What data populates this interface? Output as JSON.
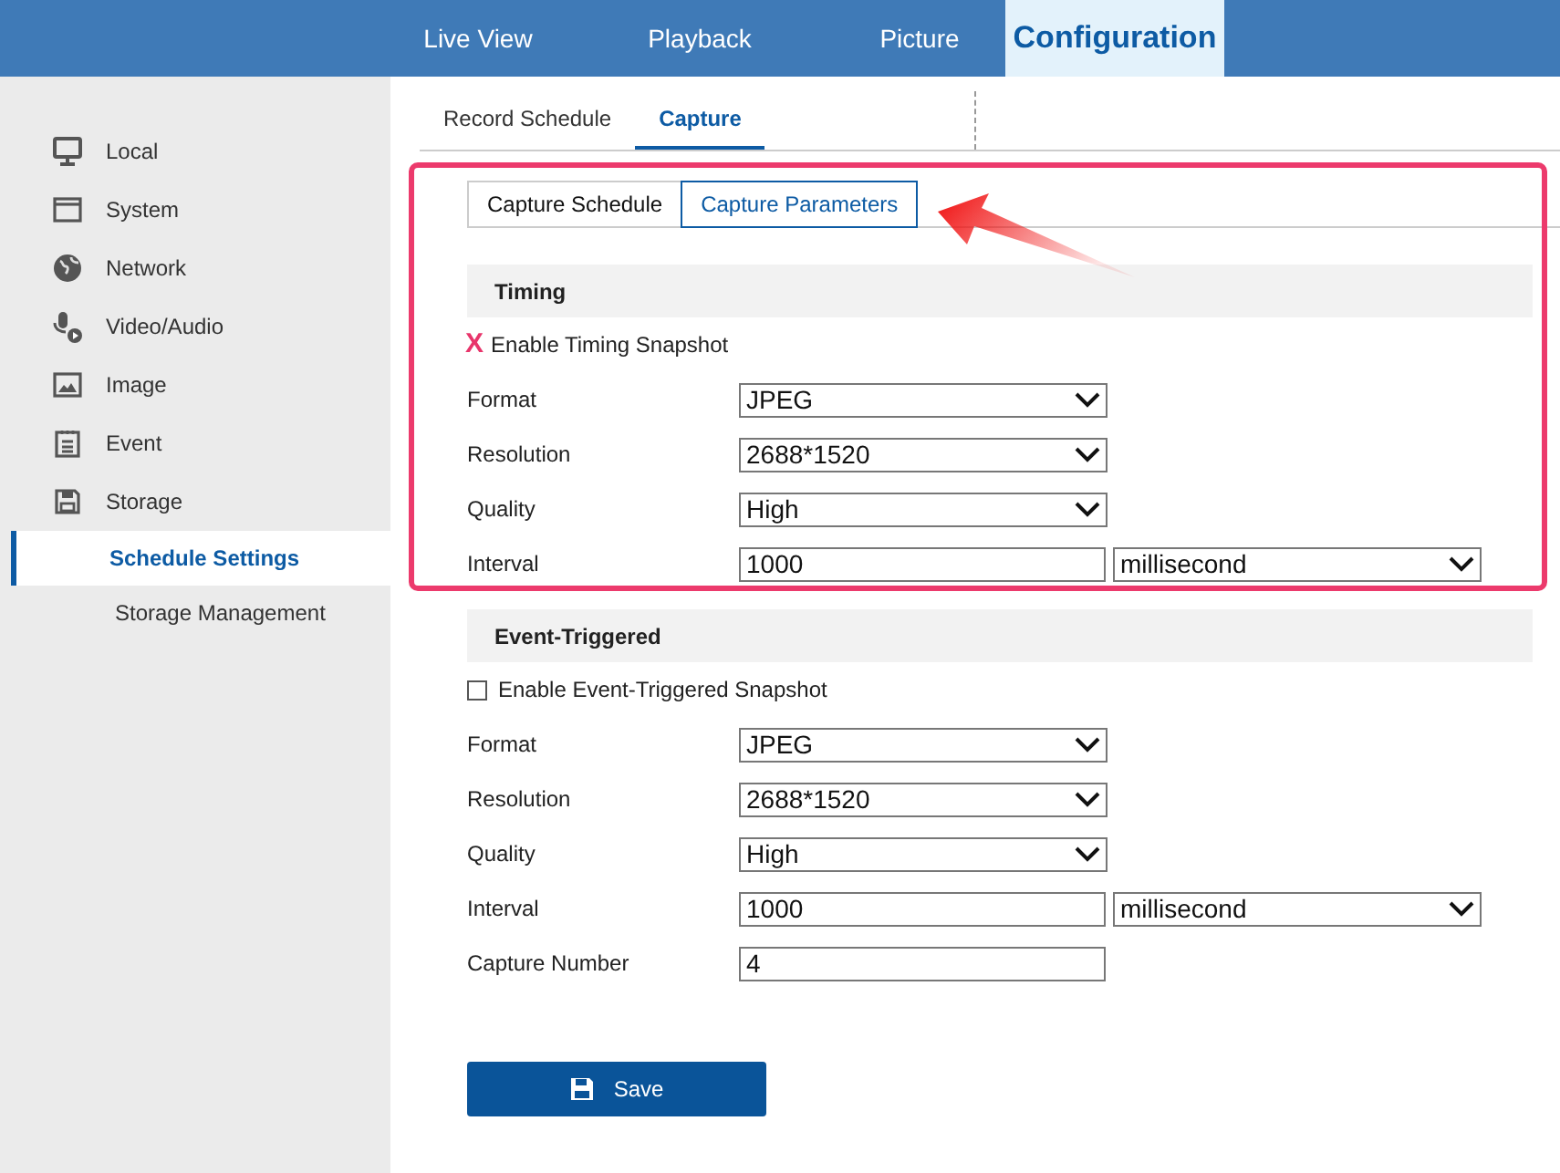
{
  "top_nav": [
    {
      "label": "Live View",
      "selected": false
    },
    {
      "label": "Playback",
      "selected": false
    },
    {
      "label": "Picture",
      "selected": false
    },
    {
      "label": "Configuration",
      "selected": true
    }
  ],
  "sidebar": {
    "items": [
      {
        "label": "Local",
        "selected": false
      },
      {
        "label": "System",
        "selected": false
      },
      {
        "label": "Network",
        "selected": false
      },
      {
        "label": "Video/Audio",
        "selected": false
      },
      {
        "label": "Image",
        "selected": false
      },
      {
        "label": "Event",
        "selected": false
      },
      {
        "label": "Storage",
        "selected": false,
        "children": [
          {
            "label": "Schedule Settings",
            "selected": true
          },
          {
            "label": "Storage Management",
            "selected": false
          }
        ]
      }
    ]
  },
  "sub_tabs": [
    {
      "label": "Record Schedule",
      "selected": false
    },
    {
      "label": "Capture",
      "selected": true
    }
  ],
  "steps": [
    {
      "label": "Capture Schedule",
      "selected": false
    },
    {
      "label": "Capture Parameters",
      "selected": true
    }
  ],
  "sections": [
    {
      "title": "Timing",
      "checkbox": {
        "label": "Enable Timing Snapshot",
        "annotation_mark": "X"
      },
      "fields": [
        {
          "label": "Format",
          "kind": "select",
          "value": "JPEG"
        },
        {
          "label": "Resolution",
          "kind": "select",
          "value": "2688*1520"
        },
        {
          "label": "Quality",
          "kind": "select",
          "value": "High"
        },
        {
          "label": "Interval",
          "kind": "input_unit",
          "value": "1000",
          "unit": "millisecond"
        }
      ]
    },
    {
      "title": "Event-Triggered",
      "checkbox": {
        "label": "Enable Event-Triggered Snapshot",
        "checked": false
      },
      "fields": [
        {
          "label": "Format",
          "kind": "select",
          "value": "JPEG"
        },
        {
          "label": "Resolution",
          "kind": "select",
          "value": "2688*1520"
        },
        {
          "label": "Quality",
          "kind": "select",
          "value": "High"
        },
        {
          "label": "Interval",
          "kind": "input_unit",
          "value": "1000",
          "unit": "millisecond"
        },
        {
          "label": "Capture Number",
          "kind": "input",
          "value": "4"
        }
      ]
    }
  ],
  "save_button": {
    "label": "Save"
  }
}
